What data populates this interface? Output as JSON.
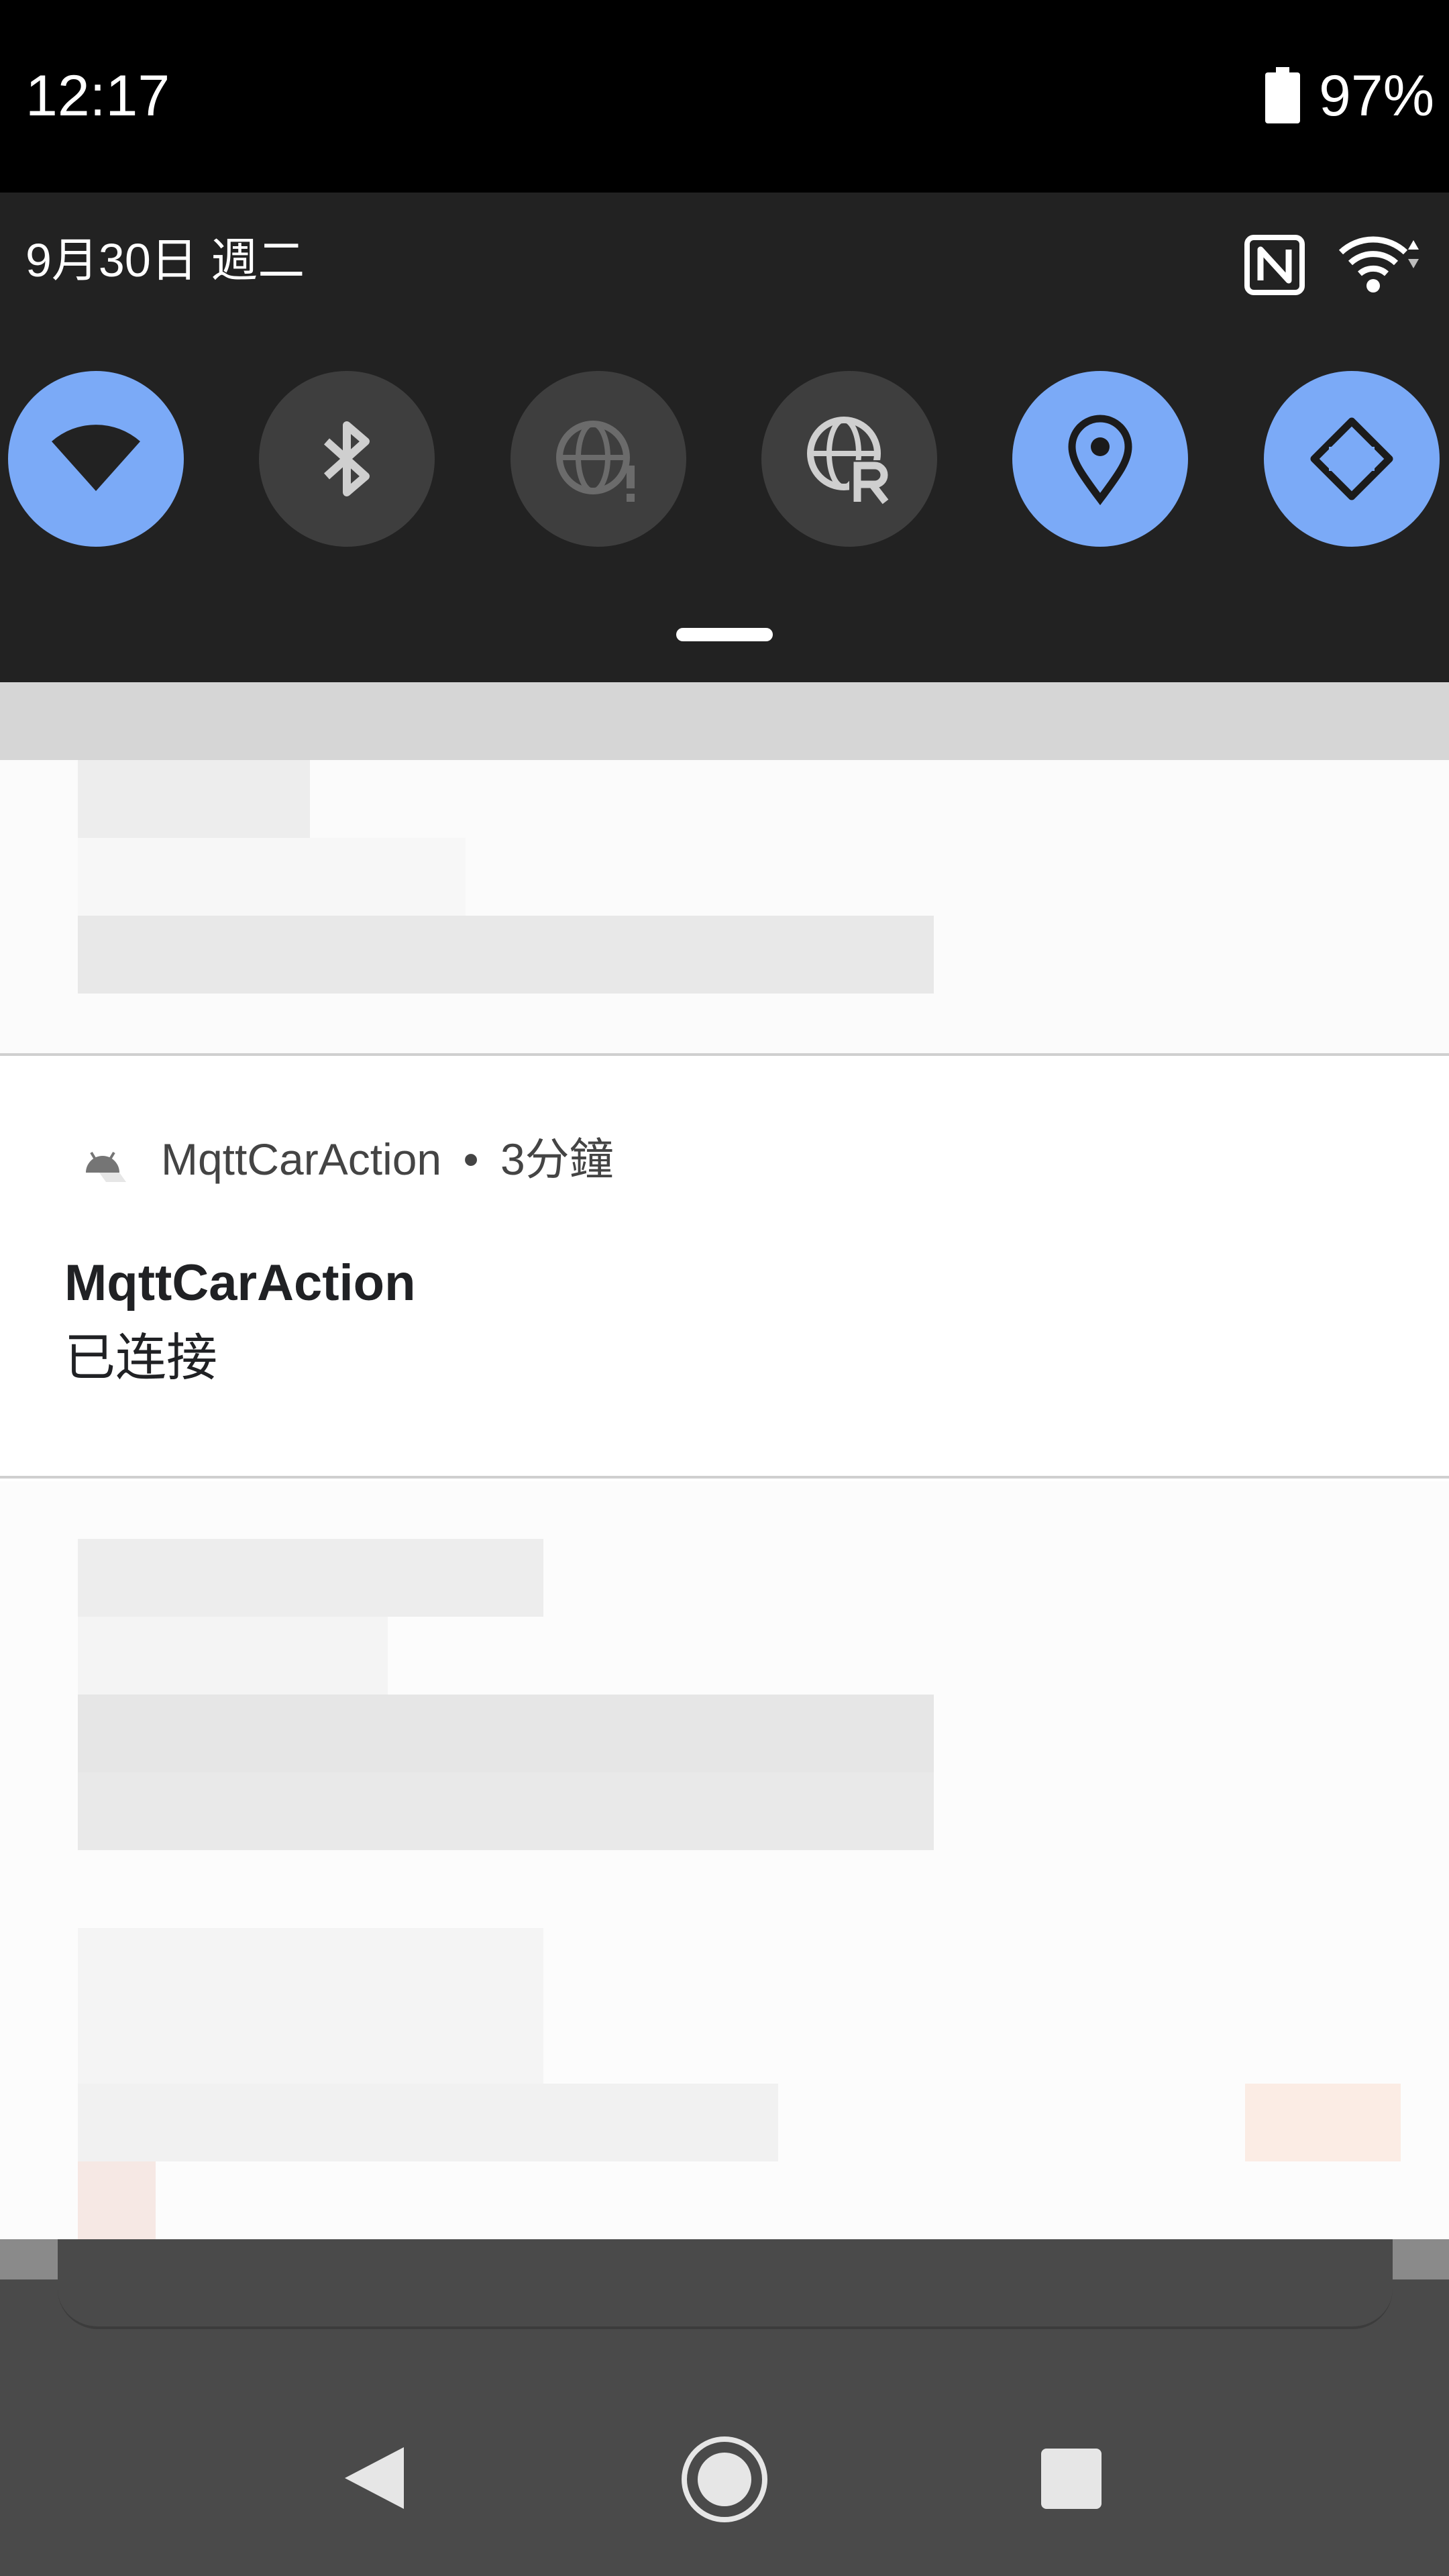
{
  "status_bar": {
    "time": "12:17",
    "battery": "97%"
  },
  "quick_settings": {
    "date": "9月30日 週二",
    "tiles": [
      {
        "name": "wifi",
        "state": "on"
      },
      {
        "name": "bluetooth",
        "state": "off"
      },
      {
        "name": "data-saver",
        "state": "off"
      },
      {
        "name": "roaming",
        "state": "off"
      },
      {
        "name": "location",
        "state": "on"
      },
      {
        "name": "auto-rotate",
        "state": "on"
      }
    ],
    "colors": {
      "on": "#7baaf7",
      "off": "#3e3e3e",
      "panel": "#222222"
    }
  },
  "notification": {
    "app_name": "MqttCarAction",
    "separator": "•",
    "time": "3分鐘",
    "title": "MqttCarAction",
    "text": "已连接"
  },
  "nav_bar": {
    "buttons": [
      "back-icon",
      "home-icon",
      "recents-icon"
    ]
  }
}
